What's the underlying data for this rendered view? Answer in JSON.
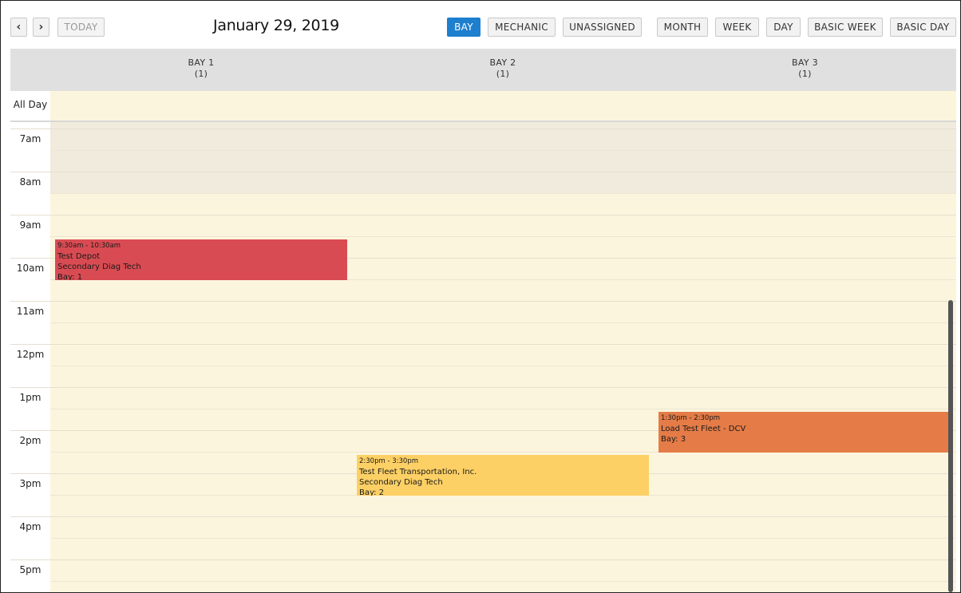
{
  "toolbar": {
    "prev_icon": "chevron-left-icon",
    "next_icon": "chevron-right-icon",
    "prev_glyph": "‹",
    "next_glyph": "›",
    "today": "TODAY",
    "title": "January 29, 2019",
    "resource_buttons": [
      "BAY",
      "MECHANIC",
      "UNASSIGNED"
    ],
    "view_buttons": [
      "MONTH",
      "WEEK",
      "DAY",
      "BASIC WEEK",
      "BASIC DAY"
    ],
    "active_resource": "BAY"
  },
  "resources": [
    {
      "name": "BAY 1",
      "count": "(1)"
    },
    {
      "name": "BAY 2",
      "count": "(1)"
    },
    {
      "name": "BAY 3",
      "count": "(1)"
    }
  ],
  "allday_label": "All Day",
  "hours": [
    "7am",
    "8am",
    "9am",
    "10am",
    "11am",
    "12pm",
    "1pm",
    "2pm",
    "3pm",
    "4pm",
    "5pm"
  ],
  "events": [
    {
      "time": "9:30am - 10:30am",
      "title": "Test Depot",
      "line2": "Secondary Diag Tech",
      "bay": "Bay: 1",
      "color": "#d94b52"
    },
    {
      "time": "2:30pm - 3:30pm",
      "title": "Test Fleet Transportation, Inc.",
      "line2": "Secondary Diag Tech",
      "bay": "Bay: 2",
      "color": "#fdd065"
    },
    {
      "time": "1:30pm - 2:30pm",
      "title": "Load Test Fleet - DCV",
      "line2": "",
      "bay": "Bay: 3",
      "color": "#e57c47"
    }
  ],
  "colors": {
    "accent": "#1e7fce",
    "grid_bg": "#fcf5dd",
    "header_bg": "#e0e0e0"
  }
}
